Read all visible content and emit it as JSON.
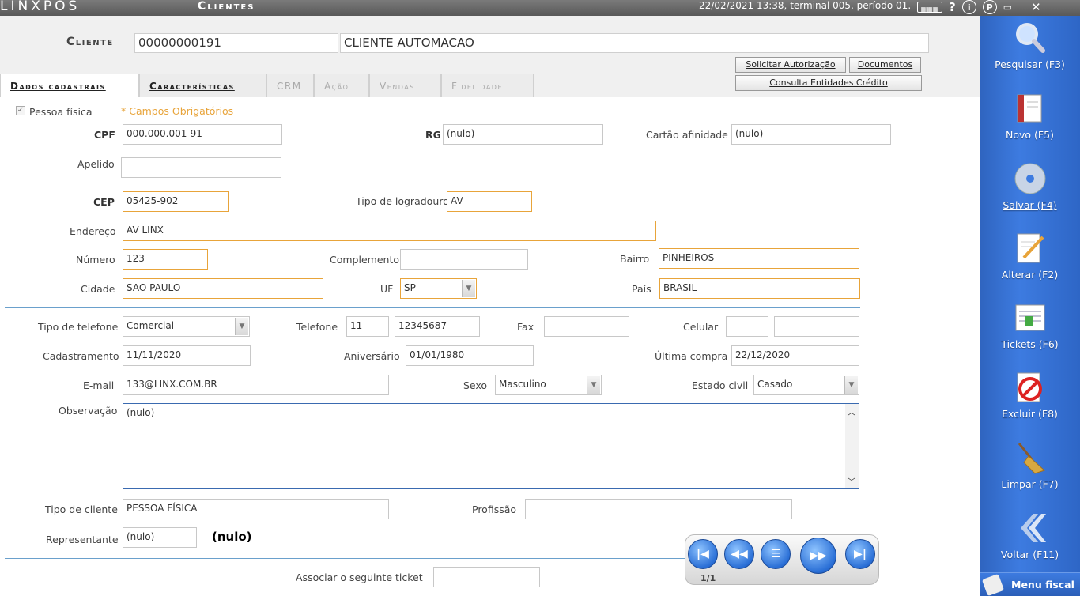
{
  "topbar": {
    "logo": "LINXPOS",
    "screen_title": "Clientes",
    "status": "22/02/2021 13:38, terminal 005, período 01."
  },
  "header": {
    "client_label": "Cliente",
    "client_code": "00000000191",
    "client_name": "CLIENTE AUTOMACAO",
    "btn_solicitar": "Solicitar Autorização",
    "btn_documentos": "Documentos",
    "btn_consulta": "Consulta Entidades Crédito"
  },
  "tabs": [
    {
      "label": "Dados cadastrais"
    },
    {
      "label": "Características"
    },
    {
      "label": "CRM"
    },
    {
      "label": "Ação"
    },
    {
      "label": "Vendas"
    },
    {
      "label": "Fidelidade"
    }
  ],
  "form": {
    "pessoa_fisica": "Pessoa física",
    "required_note": "* Campos Obrigatórios",
    "cpf_label": "CPF",
    "cpf": "000.000.001-91",
    "rg_label": "RG",
    "rg": "(nulo)",
    "cartao_label": "Cartão afinidade",
    "cartao": "(nulo)",
    "apelido_label": "Apelido",
    "apelido": "",
    "cep_label": "CEP",
    "cep": "05425-902",
    "tipo_logradouro_label": "Tipo de logradouro",
    "tipo_logradouro": "AV",
    "endereco_label": "Endereço",
    "endereco": "AV LINX",
    "numero_label": "Número",
    "numero": "123",
    "complemento_label": "Complemento",
    "complemento": "",
    "bairro_label": "Bairro",
    "bairro": "PINHEIROS",
    "cidade_label": "Cidade",
    "cidade": "SAO PAULO",
    "uf_label": "UF",
    "uf": "SP",
    "pais_label": "País",
    "pais": "BRASIL",
    "tipo_telefone_label": "Tipo de telefone",
    "tipo_telefone": "Comercial",
    "telefone_label": "Telefone",
    "telefone_ddd": "11",
    "telefone": "12345687",
    "fax_label": "Fax",
    "fax": "",
    "celular_label": "Celular",
    "celular_ddd": "",
    "celular": "",
    "cadastramento_label": "Cadastramento",
    "cadastramento": "11/11/2020",
    "aniversario_label": "Aniversário",
    "aniversario": "01/01/1980",
    "ultima_compra_label": "Última compra",
    "ultima_compra": "22/12/2020",
    "email_label": "E-mail",
    "email": "133@LINX.COM.BR",
    "sexo_label": "Sexo",
    "sexo": "Masculino",
    "estado_civil_label": "Estado civil",
    "estado_civil": "Casado",
    "observacao_label": "Observação",
    "observacao": "(nulo)",
    "tipo_cliente_label": "Tipo de cliente",
    "tipo_cliente": "PESSOA FÍSICA",
    "profissao_label": "Profissão",
    "profissao": "",
    "representante_label": "Representante",
    "representante": "(nulo)",
    "representante_name": "(nulo)",
    "associar_label": "Associar o seguinte ticket",
    "associar": ""
  },
  "navigator": {
    "count": "1/1"
  },
  "sidebar": {
    "items": [
      {
        "label": "Pesquisar (F3)",
        "icon": "search-icon"
      },
      {
        "label": "Novo (F5)",
        "icon": "new-book-icon"
      },
      {
        "label": "Salvar (F4)",
        "icon": "save-disc-icon"
      },
      {
        "label": "Alterar (F2)",
        "icon": "edit-document-icon"
      },
      {
        "label": "Tickets (F6)",
        "icon": "tickets-icon"
      },
      {
        "label": "Excluir (F8)",
        "icon": "delete-icon"
      },
      {
        "label": "Limpar (F7)",
        "icon": "broom-icon"
      },
      {
        "label": "Voltar (F11)",
        "icon": "back-arrow-icon"
      }
    ],
    "menu_fiscal": "Menu fiscal"
  }
}
